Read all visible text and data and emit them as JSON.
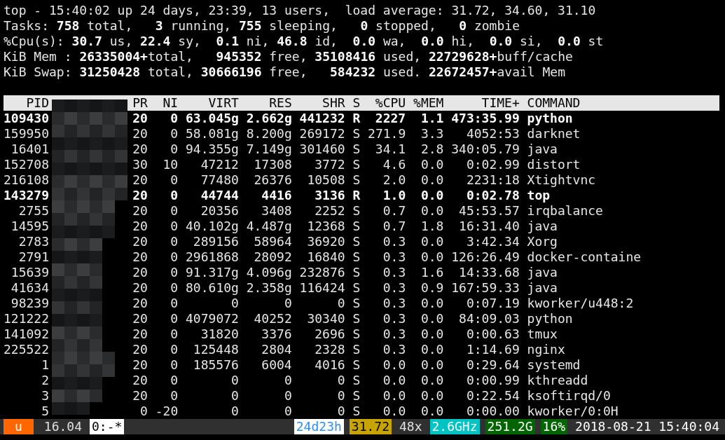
{
  "summary": [
    "top - 15:40:02 up 24 days, 23:39, 13 users,  load average: 31.72, 34.60, 31.10",
    "Tasks: **758** total,   **3** running, **755** sleeping,   **0** stopped,   **0** zombie",
    "%Cpu(s): **30.7** us, **22.4** sy,  **0.1** ni, **46.8** id,  **0.0** wa,  **0.0** hi,  **0.0** si,  **0.0** st",
    "KiB Mem : **26335004+**total,   **945352** free, **35108416** used, **22729628+**buff/cache",
    "KiB Swap: **31250428** total, **30666196** free,   **584232** used. **22672457+**avail Mem"
  ],
  "table": {
    "columns": [
      "PID",
      "PR",
      "NI",
      "VIRT",
      "RES",
      "SHR",
      "S",
      "%CPU",
      "%MEM",
      "TIME+",
      "COMMAND"
    ],
    "rows": [
      {
        "cells": [
          "109430",
          "20",
          "0",
          "63.045g",
          "2.662g",
          "441232",
          "R",
          "2227",
          "1.1",
          "473:35.99",
          "python"
        ],
        "highlighted": true
      },
      {
        "cells": [
          "159950",
          "20",
          "0",
          "58.081g",
          "8.200g",
          "269172",
          "S",
          "271.9",
          "3.3",
          "4052:53",
          "darknet"
        ],
        "highlighted": false
      },
      {
        "cells": [
          "16401",
          "20",
          "0",
          "94.355g",
          "7.149g",
          "301460",
          "S",
          "34.1",
          "2.8",
          "340:05.79",
          "java"
        ],
        "highlighted": false
      },
      {
        "cells": [
          "152708",
          "30",
          "10",
          "47212",
          "17308",
          "3772",
          "S",
          "4.6",
          "0.0",
          "0:02.99",
          "distort"
        ],
        "highlighted": false
      },
      {
        "cells": [
          "216108",
          "20",
          "0",
          "77480",
          "26376",
          "10508",
          "S",
          "2.0",
          "0.0",
          "2231:18",
          "Xtightvnc"
        ],
        "highlighted": false
      },
      {
        "cells": [
          "143279",
          "20",
          "0",
          "44744",
          "4416",
          "3136",
          "R",
          "1.0",
          "0.0",
          "0:02.78",
          "top"
        ],
        "highlighted": true
      },
      {
        "cells": [
          "2755",
          "20",
          "0",
          "20356",
          "3408",
          "2252",
          "S",
          "0.7",
          "0.0",
          "45:53.57",
          "irqbalance"
        ],
        "highlighted": false
      },
      {
        "cells": [
          "14595",
          "20",
          "0",
          "40.102g",
          "4.487g",
          "12368",
          "S",
          "0.7",
          "1.8",
          "16:31.40",
          "java"
        ],
        "highlighted": false
      },
      {
        "cells": [
          "2783",
          "20",
          "0",
          "289156",
          "58964",
          "36920",
          "S",
          "0.3",
          "0.0",
          "3:42.34",
          "Xorg"
        ],
        "highlighted": false
      },
      {
        "cells": [
          "2791",
          "20",
          "0",
          "2961868",
          "28092",
          "16840",
          "S",
          "0.3",
          "0.0",
          "126:26.49",
          "docker-containe"
        ],
        "highlighted": false
      },
      {
        "cells": [
          "15639",
          "20",
          "0",
          "91.317g",
          "4.096g",
          "232876",
          "S",
          "0.3",
          "1.6",
          "14:33.68",
          "java"
        ],
        "highlighted": false
      },
      {
        "cells": [
          "41634",
          "20",
          "0",
          "80.610g",
          "2.358g",
          "116424",
          "S",
          "0.3",
          "0.9",
          "167:59.33",
          "java"
        ],
        "highlighted": false
      },
      {
        "cells": [
          "98239",
          "20",
          "0",
          "0",
          "0",
          "0",
          "S",
          "0.3",
          "0.0",
          "0:07.19",
          "kworker/u448:2"
        ],
        "highlighted": false
      },
      {
        "cells": [
          "121222",
          "20",
          "0",
          "4079072",
          "40252",
          "30340",
          "S",
          "0.3",
          "0.0",
          "84:09.03",
          "python"
        ],
        "highlighted": false
      },
      {
        "cells": [
          "141092",
          "20",
          "0",
          "31820",
          "3376",
          "2696",
          "S",
          "0.3",
          "0.0",
          "0:00.63",
          "tmux"
        ],
        "highlighted": false
      },
      {
        "cells": [
          "225522",
          "20",
          "0",
          "125448",
          "2804",
          "2328",
          "S",
          "0.3",
          "0.0",
          "1:14.69",
          "nginx"
        ],
        "highlighted": false
      },
      {
        "cells": [
          "1",
          "20",
          "0",
          "185576",
          "6004",
          "4016",
          "S",
          "0.0",
          "0.0",
          "0:29.64",
          "systemd"
        ],
        "highlighted": false
      },
      {
        "cells": [
          "2",
          "20",
          "0",
          "0",
          "0",
          "0",
          "S",
          "0.0",
          "0.0",
          "0:00.99",
          "kthreadd"
        ],
        "highlighted": false
      },
      {
        "cells": [
          "3",
          "20",
          "0",
          "0",
          "0",
          "0",
          "S",
          "0.0",
          "0.0",
          "0:22.54",
          "ksoftirqd/0"
        ],
        "highlighted": false
      },
      {
        "cells": [
          "5",
          "0",
          "-20",
          "0",
          "0",
          "0",
          "S",
          "0.0",
          "0.0",
          "0:00.00",
          "kworker/0:0H"
        ],
        "highlighted": false
      }
    ]
  },
  "status_bar": {
    "left": [
      {
        "text": "u",
        "color": "#ff6600",
        "kind": "light"
      },
      {
        "text": "16.04",
        "color": "#303030",
        "kind": "dim"
      },
      {
        "text": "0:-*",
        "color": "#ffffff",
        "kind": "dark"
      }
    ],
    "right": [
      {
        "text": "24d23h",
        "color": "#ffffff",
        "kind": "accent"
      },
      {
        "text": "31.72",
        "color": "#c8a400",
        "kind": "dark"
      },
      {
        "text": "48x",
        "color": "#303030",
        "kind": "dim"
      },
      {
        "text": "2.6GHz",
        "color": "#00c4c4",
        "kind": "light"
      },
      {
        "text": "251.2G",
        "color": "#006400",
        "kind": "light"
      },
      {
        "text": "16%",
        "color": "#006400",
        "kind": "light"
      },
      {
        "text": "2018-08-21 15:40:04",
        "color": "#303030",
        "kind": "light"
      }
    ]
  }
}
